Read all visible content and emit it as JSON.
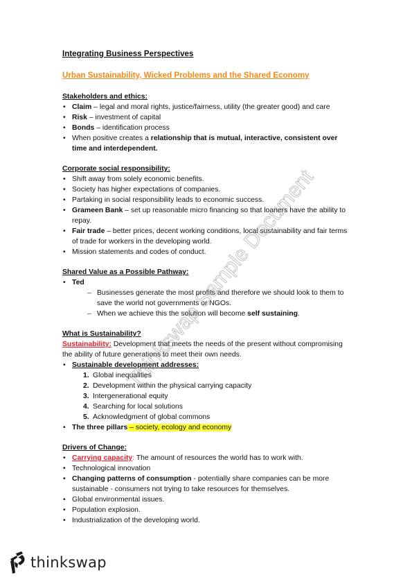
{
  "document": {
    "title": "Integrating Business Perspectives",
    "subtitle": "Urban Sustainability, Wicked Problems and the Shared Economy",
    "accent_color": "#f08a1c",
    "term_color": "#e8202a",
    "highlight_color": "#ffff33"
  },
  "sections": {
    "stakeholders": {
      "heading": "Stakeholders and ethics:",
      "items": [
        {
          "bold": "Claim",
          "text": " – legal and moral rights, justice/fairness, utility (the greater good) and care"
        },
        {
          "bold": "Risk",
          "text": " – investment of capital"
        },
        {
          "bold": "Bonds",
          "text": " – identification process"
        },
        {
          "pre": "When positive creates a ",
          "bold": "relationship that is mutual, interactive, consistent over time and interdependent."
        }
      ]
    },
    "csr": {
      "heading": "Corporate social responsibility:",
      "items": [
        {
          "text": "Shift away from solely economic benefits."
        },
        {
          "text": "Society has higher expectations of companies."
        },
        {
          "text": "Partaking in social responsibility leads to economic success."
        },
        {
          "bold": "Grameen Bank",
          "text": " – set up reasonable micro financing so that loaners have the ability to repay."
        },
        {
          "bold": "Fair trade",
          "text": " – better prices, decent working conditions, local sustainability and fair terms of trade for workers in the developing world."
        },
        {
          "text": "Mission statements and codes of conduct."
        }
      ]
    },
    "shared_value": {
      "heading": "Shared Value as a Possible Pathway:",
      "item_label": "Ted",
      "sub_items": [
        {
          "text": "Businesses generate the most profits and therefore we should look to them to save the world not governments or NGOs."
        },
        {
          "pre": "When we achieve this the solution will become ",
          "bold": "self sustaining",
          "post": "."
        }
      ]
    },
    "sustainability": {
      "heading": "What is Sustainability?",
      "term": "Sustainability:",
      "definition": " Development that meets the needs of the present without compromising the ability of future generations to meet their own needs.",
      "addresses_label": "Sustainable development addresses:",
      "addresses": [
        {
          "num": "1.",
          "text": "Global inequalities"
        },
        {
          "num": "2.",
          "text": "Development within the physical carrying capacity"
        },
        {
          "num": "3.",
          "text": "Intergenerational equity"
        },
        {
          "num": "4.",
          "text": "Searching for local solutions"
        },
        {
          "num": "5.",
          "text": "Acknowledgment of global commons"
        }
      ],
      "pillars_label": "The three pillars",
      "pillars_text": " – society, ecology and economy"
    },
    "drivers": {
      "heading": "Drivers of Change:",
      "carrying_term": "Carrying capacity",
      "carrying_colon": ":",
      "carrying_text": " The amount of resources the world has to work with.",
      "items": [
        {
          "text": "Technological innovation"
        },
        {
          "bold": "Changing patterns of consumption",
          "text": " - potentially share companies can be more sustainable - consumers not trying to take resources for themselves."
        },
        {
          "text": "Global environmental issues."
        },
        {
          "text": "Population explosion."
        },
        {
          "text": "Industrialization of the developing world."
        }
      ]
    }
  },
  "watermark": {
    "text": "Thinkswap Sample Document"
  },
  "footer": {
    "brand": "thinkswap",
    "logo_icon": "thinkswap-logo-icon"
  }
}
